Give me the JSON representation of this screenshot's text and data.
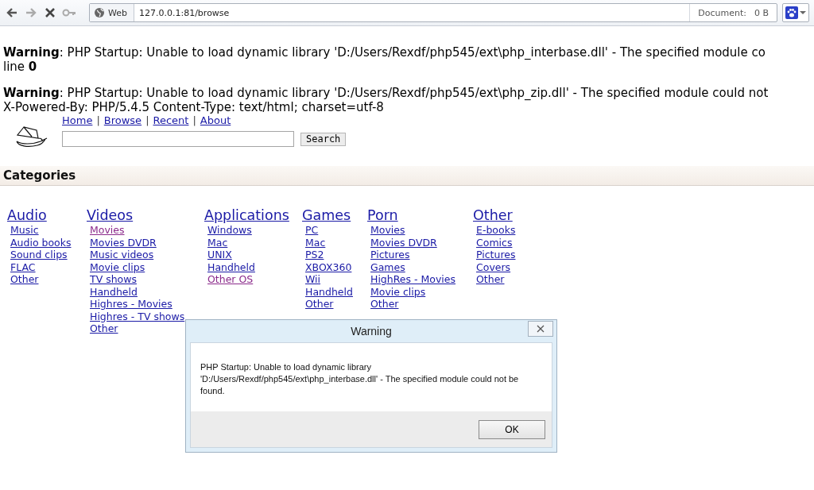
{
  "browser": {
    "mode_label": "Web",
    "url": "127.0.0.1:81/browse",
    "status_label": "Document:",
    "status_value": "0 B"
  },
  "errors": [
    {
      "text": "**Warning**: PHP Startup: Unable to load dynamic library 'D:/Users/Rexdf/php545/ext\\php_interbase.dll' - The specified module co",
      "line": "line **0**"
    },
    {
      "text": "**Warning**: PHP Startup: Unable to load dynamic library 'D:/Users/Rexdf/php545/ext\\php_zip.dll' - The specified module could not",
      "line": "X-Powered-By: PHP/5.4.5 Content-Type: text/html; charset=utf-8"
    }
  ],
  "nav": [
    "Home",
    "Browse",
    "Recent",
    "About"
  ],
  "nav_separator": "|",
  "search": {
    "button": "Search"
  },
  "section_title": "Categories",
  "categories": [
    {
      "title": "Audio",
      "items": [
        {
          "label": "Music",
          "visited": false
        },
        {
          "label": "Audio books",
          "visited": false
        },
        {
          "label": "Sound clips",
          "visited": false
        },
        {
          "label": "FLAC",
          "visited": false
        },
        {
          "label": "Other",
          "visited": false
        }
      ]
    },
    {
      "title": "Videos",
      "items": [
        {
          "label": "Movies",
          "visited": true
        },
        {
          "label": "Movies DVDR",
          "visited": false
        },
        {
          "label": "Music videos",
          "visited": false
        },
        {
          "label": "Movie clips",
          "visited": false
        },
        {
          "label": "TV shows",
          "visited": false
        },
        {
          "label": "Handheld",
          "visited": false
        },
        {
          "label": "Highres - Movies",
          "visited": false
        },
        {
          "label": "Highres - TV shows",
          "visited": false
        },
        {
          "label": "Other",
          "visited": false
        }
      ]
    },
    {
      "title": "Applications",
      "items": [
        {
          "label": "Windows",
          "visited": false
        },
        {
          "label": "Mac",
          "visited": false
        },
        {
          "label": "UNIX",
          "visited": false
        },
        {
          "label": "Handheld",
          "visited": false
        },
        {
          "label": "Other OS",
          "visited": true
        }
      ]
    },
    {
      "title": "Games",
      "items": [
        {
          "label": "PC",
          "visited": false
        },
        {
          "label": "Mac",
          "visited": false
        },
        {
          "label": "PS2",
          "visited": false
        },
        {
          "label": "XBOX360",
          "visited": false
        },
        {
          "label": "Wii",
          "visited": false
        },
        {
          "label": "Handheld",
          "visited": false
        },
        {
          "label": "Other",
          "visited": false
        }
      ]
    },
    {
      "title": "Porn",
      "items": [
        {
          "label": "Movies",
          "visited": false
        },
        {
          "label": "Movies DVDR",
          "visited": false
        },
        {
          "label": "Pictures",
          "visited": false
        },
        {
          "label": "Games",
          "visited": false
        },
        {
          "label": "HighRes - Movies",
          "visited": false
        },
        {
          "label": "Movie clips",
          "visited": false
        },
        {
          "label": "Other",
          "visited": false
        }
      ]
    },
    {
      "title": "Other",
      "items": [
        {
          "label": "E-books",
          "visited": false
        },
        {
          "label": "Comics",
          "visited": false
        },
        {
          "label": "Pictures",
          "visited": false
        },
        {
          "label": "Covers",
          "visited": false
        },
        {
          "label": "Other",
          "visited": false
        }
      ]
    }
  ],
  "dialog": {
    "title": "Warning",
    "message": "PHP Startup: Unable to load dynamic library 'D:/Users/Rexdf/php545/ext\\php_interbase.dll' - The specified module could not be found.",
    "button": "OK"
  }
}
